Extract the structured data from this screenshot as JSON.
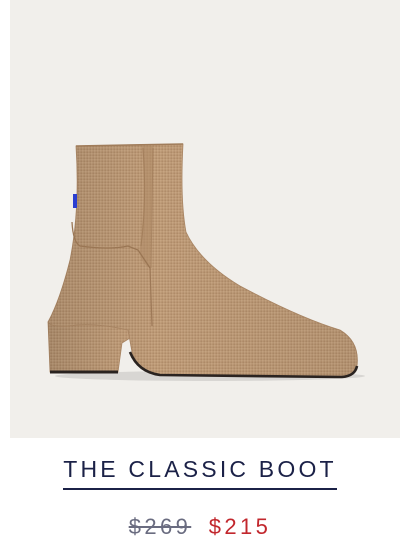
{
  "product": {
    "title": "THE CLASSIC BOOT",
    "price_original": "$269",
    "price_sale": "$215",
    "image_alt": "Classic boot in camel knit",
    "colors": {
      "panel_bg": "#f1efeb",
      "title": "#1b2147",
      "original_price": "#6a6c80",
      "sale_price": "#c2272d",
      "boot_body": "#bd9a77",
      "heel_tab": "#2b3fd1"
    }
  }
}
